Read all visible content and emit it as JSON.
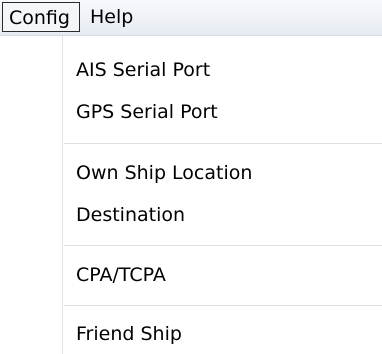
{
  "menubar": {
    "items": [
      {
        "label": "Config"
      },
      {
        "label": "Help"
      }
    ]
  },
  "config_menu": {
    "items": [
      {
        "label": "AIS Serial Port"
      },
      {
        "label": "GPS Serial Port"
      },
      {
        "label": "Own Ship Location"
      },
      {
        "label": "Destination"
      },
      {
        "label": "CPA/TCPA"
      },
      {
        "label": "Friend Ship"
      }
    ]
  }
}
